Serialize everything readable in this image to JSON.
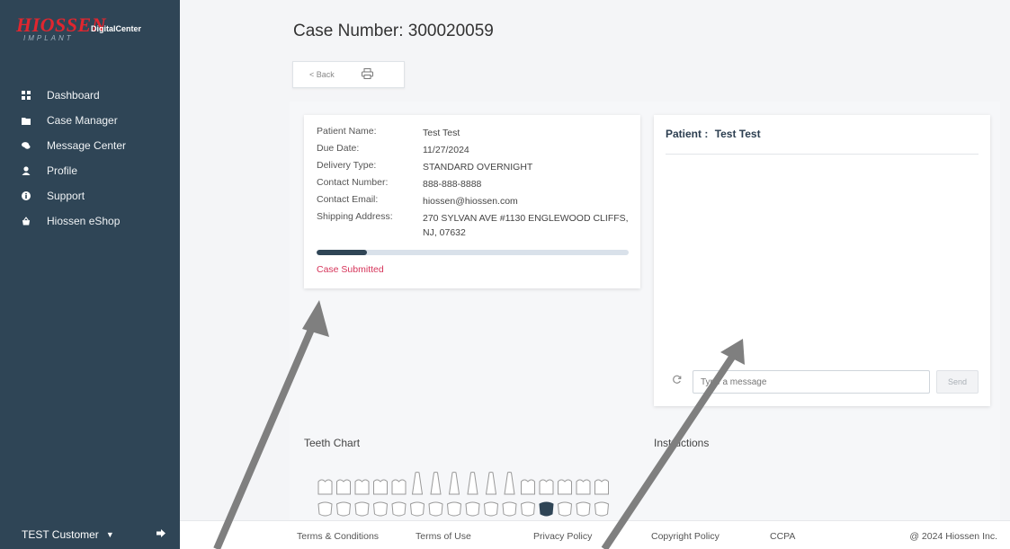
{
  "sidebar": {
    "logo_brand": "HIOSSEN",
    "logo_sub": "IMPLANT",
    "logo_product": "DigitalCenter",
    "items": [
      {
        "label": "Dashboard",
        "icon": "dashboard-icon"
      },
      {
        "label": "Case Manager",
        "icon": "folder-icon"
      },
      {
        "label": "Message Center",
        "icon": "chat-icon"
      },
      {
        "label": "Profile",
        "icon": "user-icon"
      },
      {
        "label": "Support",
        "icon": "info-icon"
      },
      {
        "label": "Hiossen eShop",
        "icon": "basket-icon"
      }
    ],
    "user_name": "TEST Customer"
  },
  "page": {
    "title": "Case Number:  300020059",
    "back_label": "< Back"
  },
  "case_info": {
    "rows": [
      {
        "label": "Patient Name:",
        "value": "Test Test"
      },
      {
        "label": "Due Date:",
        "value": "11/27/2024"
      },
      {
        "label": "Delivery Type:",
        "value": "STANDARD OVERNIGHT"
      },
      {
        "label": "Contact Number:",
        "value": "888-888-8888"
      },
      {
        "label": "Contact Email:",
        "value": "hiossen@hiossen.com"
      },
      {
        "label": "Shipping Address:",
        "value": "270 SYLVAN AVE #1130 ENGLEWOOD CLIFFS, NJ, 07632"
      }
    ],
    "progress_fraction": 0.16,
    "status": "Case Submitted"
  },
  "chat": {
    "title_label": "Patient :",
    "patient_name": "Test Test",
    "input_placeholder": "Type a message",
    "send_label": "Send"
  },
  "sections": {
    "teeth_chart": "Teeth Chart",
    "instructions": "Instructions"
  },
  "teeth": {
    "selected_lower_index": 12,
    "selected_color": "#2f4556"
  },
  "footer": {
    "links": [
      "Terms & Conditions",
      "Terms of Use",
      "Privacy Policy",
      "Copyright Policy",
      "CCPA"
    ],
    "copyright": "@ 2024 Hiossen Inc."
  },
  "colors": {
    "sidebar_bg": "#2f4556",
    "brand_red": "#e0262f",
    "status_pink": "#d6345a",
    "arrow_gray": "#7f7f7f"
  }
}
